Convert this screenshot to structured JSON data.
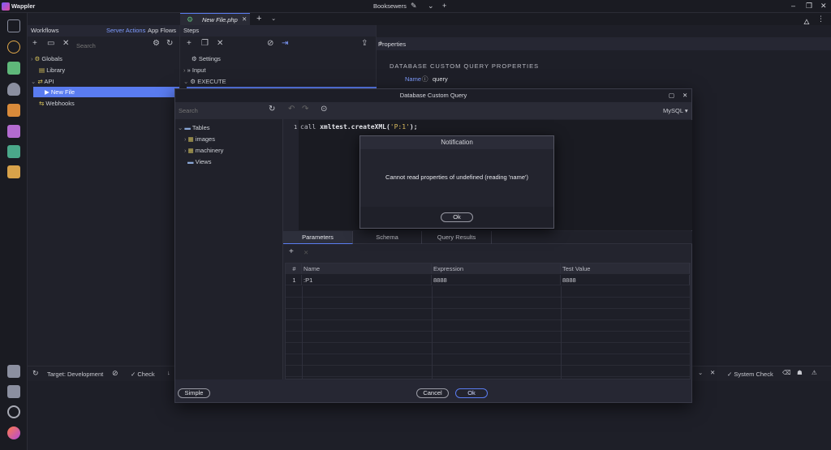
{
  "app": {
    "name": "Wappler",
    "project": "Booksewers"
  },
  "workflows": {
    "header": "Workflows",
    "tabs": [
      "Server Actions",
      "App Flows"
    ],
    "search_placeholder": "Search",
    "tree": [
      "Globals",
      "Library",
      "API",
      "New File",
      "Webhooks"
    ]
  },
  "editor_tab": {
    "label": "New File.php"
  },
  "steps": {
    "header": "Steps",
    "items": [
      "Settings",
      "Input",
      "EXECUTE"
    ]
  },
  "properties": {
    "header": "Properties",
    "section": "DATABASE CUSTOM QUERY PROPERTIES",
    "name_label": "Name",
    "name_value": "query"
  },
  "dialog": {
    "title": "Database Custom Query",
    "search_placeholder": "Search",
    "db_type": "MySQL",
    "schema_tree": [
      "Tables",
      "images",
      "machinery",
      "Views"
    ],
    "line_number": "1",
    "code": {
      "kw": "call ",
      "fn": "xmltest.createXML(",
      "str": "'P:1'",
      "end": ");"
    },
    "tabs": [
      "Parameters",
      "Schema",
      "Query Results"
    ],
    "grid": {
      "columns": [
        "#",
        "Name",
        "Expression",
        "Test Value"
      ],
      "rows": [
        [
          "1",
          ":P1",
          "8888",
          "8888"
        ]
      ]
    },
    "buttons": {
      "simple": "Simple",
      "cancel": "Cancel",
      "ok": "Ok"
    }
  },
  "notification": {
    "title": "Notification",
    "message": "Cannot read properties of undefined (reading 'name')",
    "ok": "Ok"
  },
  "bottom": {
    "target": "Target: Development",
    "check": "Check",
    "system_check": "System Check"
  },
  "colors": {
    "accent": "#5a7cf0",
    "background": "#1e1f28"
  }
}
